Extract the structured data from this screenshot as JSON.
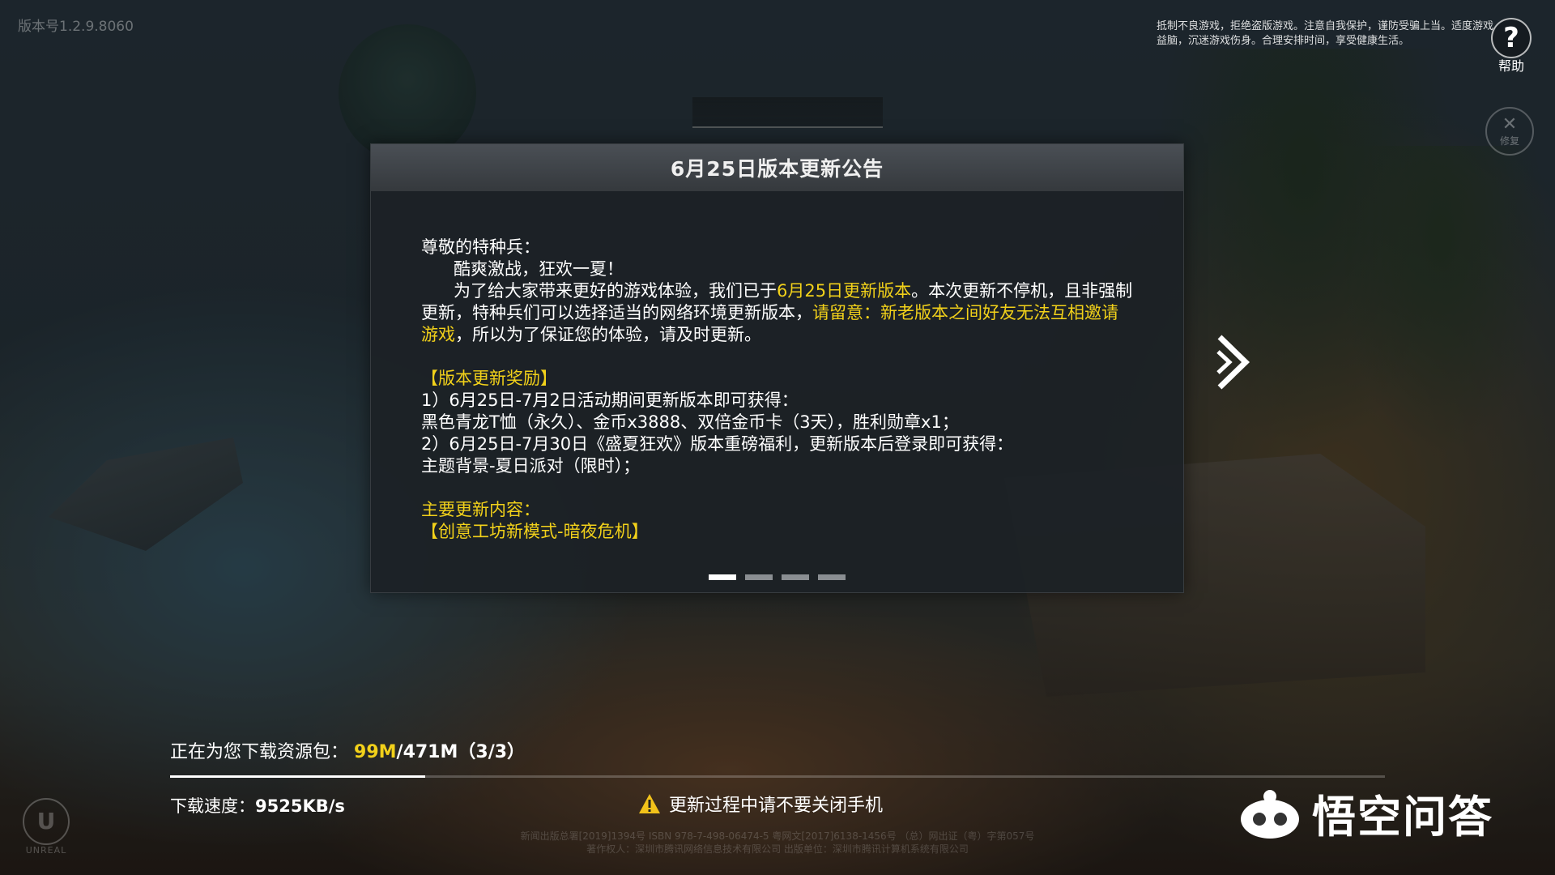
{
  "version_label": "版本号1.2.9.8060",
  "health_notice": "抵制不良游戏，拒绝盗版游戏。注意自我保护，谨防受骗上当。适度游戏益脑，沉迷游戏伤身。合理安排时间，享受健康生活。",
  "help": {
    "icon": "?",
    "label": "帮助"
  },
  "repair": {
    "label": "修复"
  },
  "dialog": {
    "title": "6月25日版本更新公告",
    "greeting": "尊敬的特种兵：",
    "slogan": "酷爽激战，狂欢一夏！",
    "para1_a": "为了给大家带来更好的游戏体验，我们已于",
    "para1_hl1": "6月25日更新版本",
    "para1_b": "。本次更新不停机，且非强制更新，特种兵们可以选择适当的网络环境更新版本，",
    "para1_hl2": "请留意：新老版本之间好友无法互相邀请游戏",
    "para1_c": "，所以为了保证您的体验，请及时更新。",
    "reward_title": "【版本更新奖励】",
    "reward_1": "1）6月25日-7月2日活动期间更新版本即可获得：",
    "reward_1_items": "黑色青龙T恤（永久）、金币x3888、双倍金币卡（3天），胜利勋章x1；",
    "reward_2": "2）6月25日-7月30日《盛夏狂欢》版本重磅福利，更新版本后登录即可获得：",
    "reward_2_items": "主题背景-夏日派对（限时）；",
    "main_title": "主要更新内容：",
    "main_item": "【创意工坊新模式-暗夜危机】",
    "pages": 4,
    "active_page": 1
  },
  "download": {
    "label": "正在为您下载资源包：",
    "current": "99M",
    "total": "/471M（3/3）",
    "progress": 0.21,
    "speed_label": "下载速度：",
    "speed_value": "9525KB/s",
    "warning": "更新过程中请不要关闭手机"
  },
  "legal_line1": "新闻出版总署[2019]1394号   ISBN 978-7-498-06474-5   粤网文[2017]6138-1456号   （总）网出证（粤）字第057号",
  "legal_line2": "著作权人：深圳市腾讯网络信息技术有限公司    出版单位：深圳市腾讯计算机系统有限公司",
  "engine_logo": "UNREAL",
  "watermark": "悟空问答",
  "colors": {
    "highlight": "#f2d11a",
    "dialog_bg": "#1c2126",
    "header_bg": "#404549"
  }
}
